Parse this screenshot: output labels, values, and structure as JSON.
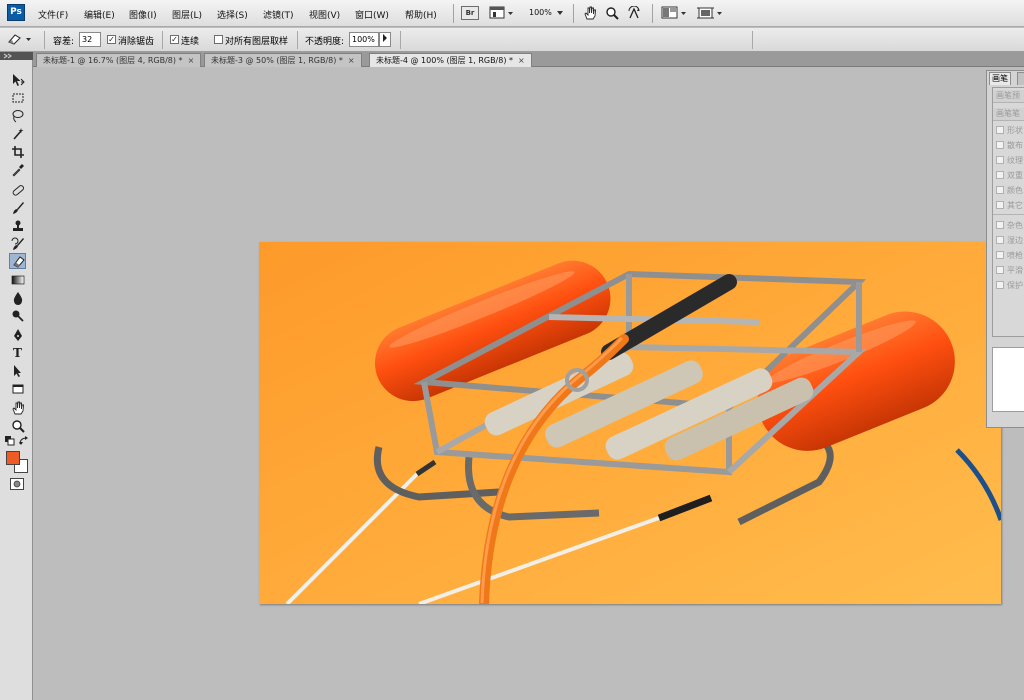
{
  "app": {
    "logo": "Ps"
  },
  "menu": [
    "文件(F)",
    "编辑(E)",
    "图像(I)",
    "图层(L)",
    "选择(S)",
    "滤镜(T)",
    "视图(V)",
    "窗口(W)",
    "帮助(H)"
  ],
  "menubar_tools": {
    "bridge_label": "Br",
    "zoom": "100%",
    "icons": [
      "bridge-icon",
      "screen-mode-icon",
      "hand-icon",
      "zoom-icon",
      "rotate-view-icon",
      "arrange-documents-icon",
      "screen-mode-frame-icon"
    ]
  },
  "options": {
    "tolerance_label": "容差:",
    "tolerance_value": "32",
    "antialias_label": "消除锯齿",
    "contiguous_label": "连续",
    "sample_all_label": "对所有图层取样",
    "opacity_label": "不透明度:",
    "opacity_value": "100%",
    "antialias_checked": true,
    "contiguous_checked": true,
    "sample_all_checked": false
  },
  "tabs": [
    {
      "label": "未标题-1 @ 16.7% (图层 4, RGB/8) *",
      "close": "×",
      "active": false
    },
    {
      "label": "未标题-3 @ 50% (图层 1, RGB/8) *",
      "close": "×",
      "active": false
    },
    {
      "label": "未标题-4 @ 100% (图层 1, RGB/8) *",
      "close": "×",
      "active": true
    }
  ],
  "tools": [
    "move-tool-icon",
    "marquee-tool-icon",
    "lasso-tool-icon",
    "magic-wand-tool-icon",
    "crop-tool-icon",
    "eyedropper-tool-icon",
    "healing-brush-tool-icon",
    "brush-tool-icon",
    "clone-stamp-tool-icon",
    "history-brush-tool-icon",
    "eraser-tool-icon",
    "gradient-tool-icon",
    "blur-tool-icon",
    "dodge-tool-icon",
    "pen-tool-icon",
    "type-tool-icon",
    "path-selection-tool-icon",
    "shape-tool-icon",
    "hand-tool-icon",
    "zoom-tool-icon"
  ],
  "type_tool_glyph": "T",
  "colors": {
    "foreground": "#ef5b24",
    "background": "#ffffff",
    "canvas_bg": "#ffa733",
    "float_orange": "#ff5a12"
  },
  "panel": {
    "tab_label": "画笔",
    "header1": "画笔预",
    "header2": "画笔笔",
    "rows": [
      "形状",
      "散布",
      "纹理",
      "双重",
      "颜色",
      "其它",
      "杂色",
      "湿边",
      "喷枪",
      "平滑",
      "保护"
    ]
  }
}
